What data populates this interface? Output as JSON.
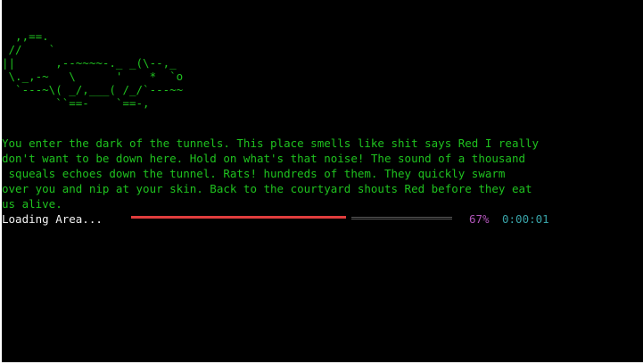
{
  "ascii_art": [
    "  ,,==.",
    " //    `",
    "||      ,--~~~~-._ _(\\--,_",
    " \\._,-~   \\      '    *  `o",
    "  `---~\\( _/,___( /_/`---~~",
    "        ``==-    `==-,"
  ],
  "story": {
    "lines": [
      "You enter the dark of the tunnels. This place smells like shit says Red I really",
      "don't want to be down here. Hold on what's that noise! The sound of a thousand",
      " squeals echoes down the tunnel. Rats! hundreds of them. They quickly swarm",
      "over you and nip at your skin. Back to the courtyard shouts Red before they eat",
      "us alive."
    ]
  },
  "loading": {
    "label": "Loading Area...",
    "progress_fraction": 0.67,
    "percent_text": "67%",
    "elapsed_text": "0:00:01"
  },
  "colors": {
    "background": "#000000",
    "story_text": "#1fc21f",
    "loading_label": "#f2f2f2",
    "bar_filled": "#e03c3c",
    "bar_remaining": "#5a5a5a",
    "percent": "#b054b8",
    "elapsed": "#38a3a8"
  }
}
